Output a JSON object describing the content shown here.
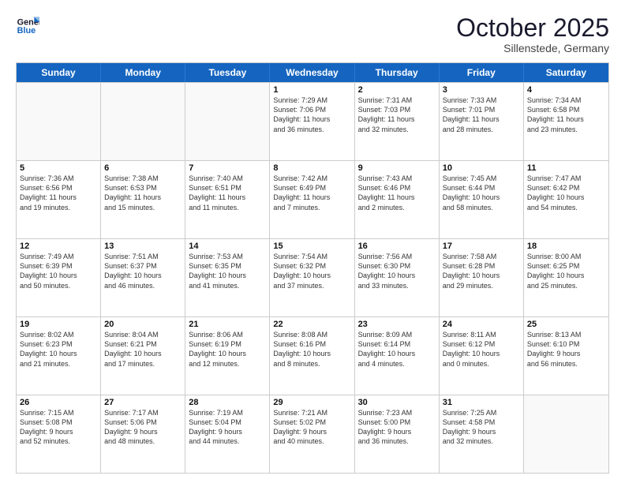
{
  "logo": {
    "line1": "General",
    "line2": "Blue"
  },
  "title": "October 2025",
  "location": "Sillenstede, Germany",
  "days": [
    "Sunday",
    "Monday",
    "Tuesday",
    "Wednesday",
    "Thursday",
    "Friday",
    "Saturday"
  ],
  "rows": [
    [
      {
        "date": "",
        "info": ""
      },
      {
        "date": "",
        "info": ""
      },
      {
        "date": "",
        "info": ""
      },
      {
        "date": "1",
        "info": "Sunrise: 7:29 AM\nSunset: 7:06 PM\nDaylight: 11 hours\nand 36 minutes."
      },
      {
        "date": "2",
        "info": "Sunrise: 7:31 AM\nSunset: 7:03 PM\nDaylight: 11 hours\nand 32 minutes."
      },
      {
        "date": "3",
        "info": "Sunrise: 7:33 AM\nSunset: 7:01 PM\nDaylight: 11 hours\nand 28 minutes."
      },
      {
        "date": "4",
        "info": "Sunrise: 7:34 AM\nSunset: 6:58 PM\nDaylight: 11 hours\nand 23 minutes."
      }
    ],
    [
      {
        "date": "5",
        "info": "Sunrise: 7:36 AM\nSunset: 6:56 PM\nDaylight: 11 hours\nand 19 minutes."
      },
      {
        "date": "6",
        "info": "Sunrise: 7:38 AM\nSunset: 6:53 PM\nDaylight: 11 hours\nand 15 minutes."
      },
      {
        "date": "7",
        "info": "Sunrise: 7:40 AM\nSunset: 6:51 PM\nDaylight: 11 hours\nand 11 minutes."
      },
      {
        "date": "8",
        "info": "Sunrise: 7:42 AM\nSunset: 6:49 PM\nDaylight: 11 hours\nand 7 minutes."
      },
      {
        "date": "9",
        "info": "Sunrise: 7:43 AM\nSunset: 6:46 PM\nDaylight: 11 hours\nand 2 minutes."
      },
      {
        "date": "10",
        "info": "Sunrise: 7:45 AM\nSunset: 6:44 PM\nDaylight: 10 hours\nand 58 minutes."
      },
      {
        "date": "11",
        "info": "Sunrise: 7:47 AM\nSunset: 6:42 PM\nDaylight: 10 hours\nand 54 minutes."
      }
    ],
    [
      {
        "date": "12",
        "info": "Sunrise: 7:49 AM\nSunset: 6:39 PM\nDaylight: 10 hours\nand 50 minutes."
      },
      {
        "date": "13",
        "info": "Sunrise: 7:51 AM\nSunset: 6:37 PM\nDaylight: 10 hours\nand 46 minutes."
      },
      {
        "date": "14",
        "info": "Sunrise: 7:53 AM\nSunset: 6:35 PM\nDaylight: 10 hours\nand 41 minutes."
      },
      {
        "date": "15",
        "info": "Sunrise: 7:54 AM\nSunset: 6:32 PM\nDaylight: 10 hours\nand 37 minutes."
      },
      {
        "date": "16",
        "info": "Sunrise: 7:56 AM\nSunset: 6:30 PM\nDaylight: 10 hours\nand 33 minutes."
      },
      {
        "date": "17",
        "info": "Sunrise: 7:58 AM\nSunset: 6:28 PM\nDaylight: 10 hours\nand 29 minutes."
      },
      {
        "date": "18",
        "info": "Sunrise: 8:00 AM\nSunset: 6:25 PM\nDaylight: 10 hours\nand 25 minutes."
      }
    ],
    [
      {
        "date": "19",
        "info": "Sunrise: 8:02 AM\nSunset: 6:23 PM\nDaylight: 10 hours\nand 21 minutes."
      },
      {
        "date": "20",
        "info": "Sunrise: 8:04 AM\nSunset: 6:21 PM\nDaylight: 10 hours\nand 17 minutes."
      },
      {
        "date": "21",
        "info": "Sunrise: 8:06 AM\nSunset: 6:19 PM\nDaylight: 10 hours\nand 12 minutes."
      },
      {
        "date": "22",
        "info": "Sunrise: 8:08 AM\nSunset: 6:16 PM\nDaylight: 10 hours\nand 8 minutes."
      },
      {
        "date": "23",
        "info": "Sunrise: 8:09 AM\nSunset: 6:14 PM\nDaylight: 10 hours\nand 4 minutes."
      },
      {
        "date": "24",
        "info": "Sunrise: 8:11 AM\nSunset: 6:12 PM\nDaylight: 10 hours\nand 0 minutes."
      },
      {
        "date": "25",
        "info": "Sunrise: 8:13 AM\nSunset: 6:10 PM\nDaylight: 9 hours\nand 56 minutes."
      }
    ],
    [
      {
        "date": "26",
        "info": "Sunrise: 7:15 AM\nSunset: 5:08 PM\nDaylight: 9 hours\nand 52 minutes."
      },
      {
        "date": "27",
        "info": "Sunrise: 7:17 AM\nSunset: 5:06 PM\nDaylight: 9 hours\nand 48 minutes."
      },
      {
        "date": "28",
        "info": "Sunrise: 7:19 AM\nSunset: 5:04 PM\nDaylight: 9 hours\nand 44 minutes."
      },
      {
        "date": "29",
        "info": "Sunrise: 7:21 AM\nSunset: 5:02 PM\nDaylight: 9 hours\nand 40 minutes."
      },
      {
        "date": "30",
        "info": "Sunrise: 7:23 AM\nSunset: 5:00 PM\nDaylight: 9 hours\nand 36 minutes."
      },
      {
        "date": "31",
        "info": "Sunrise: 7:25 AM\nSunset: 4:58 PM\nDaylight: 9 hours\nand 32 minutes."
      },
      {
        "date": "",
        "info": ""
      }
    ]
  ]
}
